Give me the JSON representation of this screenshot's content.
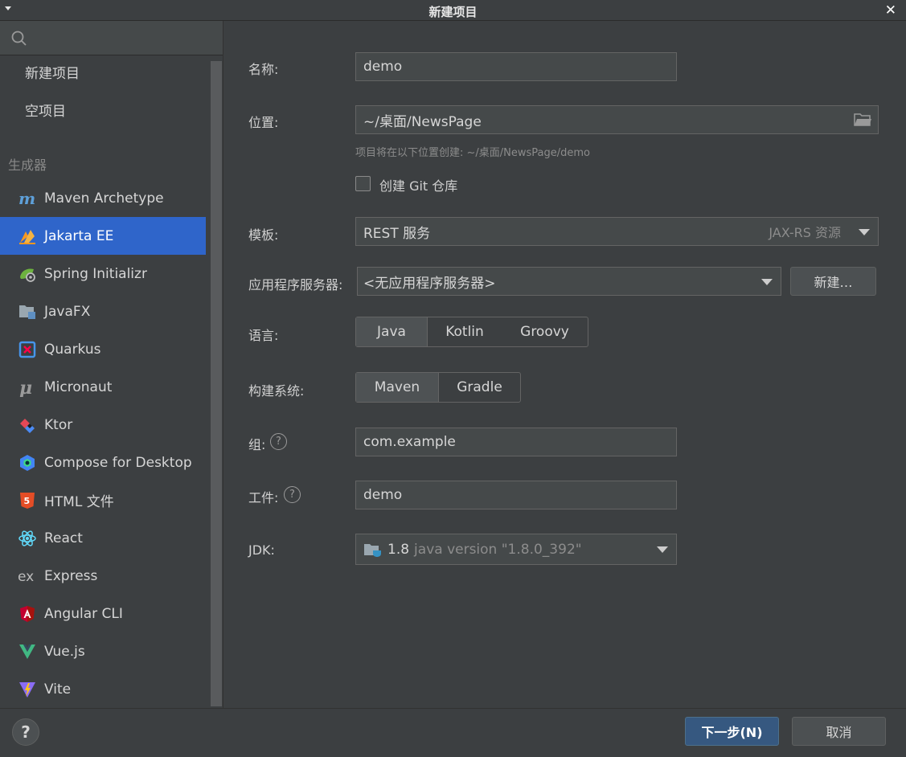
{
  "window": {
    "title": "新建项目"
  },
  "sidebar": {
    "search_placeholder": "",
    "top_items": [
      {
        "label": "新建项目"
      },
      {
        "label": "空项目"
      }
    ],
    "section_label": "生成器",
    "generators": [
      {
        "label": "Maven Archetype",
        "icon": "maven-icon"
      },
      {
        "label": "Jakarta EE",
        "icon": "jakarta-ee-icon",
        "selected": true
      },
      {
        "label": "Spring Initializr",
        "icon": "spring-icon"
      },
      {
        "label": "JavaFX",
        "icon": "javafx-icon"
      },
      {
        "label": "Quarkus",
        "icon": "quarkus-icon"
      },
      {
        "label": "Micronaut",
        "icon": "micronaut-icon"
      },
      {
        "label": "Ktor",
        "icon": "ktor-icon"
      },
      {
        "label": "Compose for Desktop",
        "icon": "compose-icon"
      },
      {
        "label": "HTML 文件",
        "icon": "html5-icon"
      },
      {
        "label": "React",
        "icon": "react-icon"
      },
      {
        "label": "Express",
        "icon": "express-icon"
      },
      {
        "label": "Angular CLI",
        "icon": "angular-icon"
      },
      {
        "label": "Vue.js",
        "icon": "vue-icon"
      },
      {
        "label": "Vite",
        "icon": "vite-icon"
      }
    ]
  },
  "form": {
    "name_label": "名称:",
    "name_value": "demo",
    "location_label": "位置:",
    "location_value": "~/桌面/NewsPage",
    "location_hint": "项目将在以下位置创建: ~/桌面/NewsPage/demo",
    "git_label": "创建 Git 仓库",
    "git_checked": false,
    "template_label": "模板:",
    "template_value": "REST 服务",
    "template_detail": "JAX-RS 资源",
    "server_label": "应用程序服务器:",
    "server_value": "<无应用程序服务器>",
    "server_new_button": "新建…",
    "language_label": "语言:",
    "languages": [
      "Java",
      "Kotlin",
      "Groovy"
    ],
    "language_selected": "Java",
    "build_label": "构建系统:",
    "build_systems": [
      "Maven",
      "Gradle"
    ],
    "build_selected": "Maven",
    "group_label": "组:",
    "group_value": "com.example",
    "artifact_label": "工件:",
    "artifact_value": "demo",
    "jdk_label": "JDK:",
    "jdk_version": "1.8",
    "jdk_detail": "java version \"1.8.0_392\""
  },
  "footer": {
    "help_label": "?",
    "next_label": "下一步(N)",
    "cancel_label": "取消"
  }
}
